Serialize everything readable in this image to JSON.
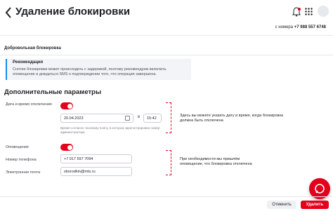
{
  "header": {
    "title": "Удаление блокировки"
  },
  "phone_line": {
    "prefix": "с номера",
    "number": "+7 988 557 6748"
  },
  "sections": {
    "voluntary": "Добровольная блокировка"
  },
  "recommendation": {
    "title": "Рекомендация",
    "text": "Снятие блокировки может происходить с задержкой, поэтому рекомендуем включить оповещение и дождаться SMS о подтверждении того, что операция завершена."
  },
  "params": {
    "title": "Дополнительные параметры",
    "datetime_label": "Дата и время отключения",
    "date_value": "20.04.2023",
    "time_sep": "в",
    "time_value": "15:42",
    "hint": "Время согласно часовому поясу, в котором зарегистрирован номер администратора",
    "datetime_note": "Здесь вы можете указать дату и время, когда блокировка должна быть отключена",
    "notify_label": "Оповещение",
    "phone_label": "Номер телефона",
    "phone_value": "+7 917 597 7094",
    "email_label": "Электронная почта",
    "email_value": "sborodkin@mts.ru",
    "notify_note": "При необходимости мы пришлём оповещение, что блокировка отключена"
  },
  "toggles": {
    "datetime_on": true,
    "notify_on": true
  },
  "footer": {
    "cancel_label": "Отменить",
    "delete_label": "Удалить"
  },
  "colors": {
    "accent": "#e3001b",
    "info_bar": "#1e8ae6"
  }
}
